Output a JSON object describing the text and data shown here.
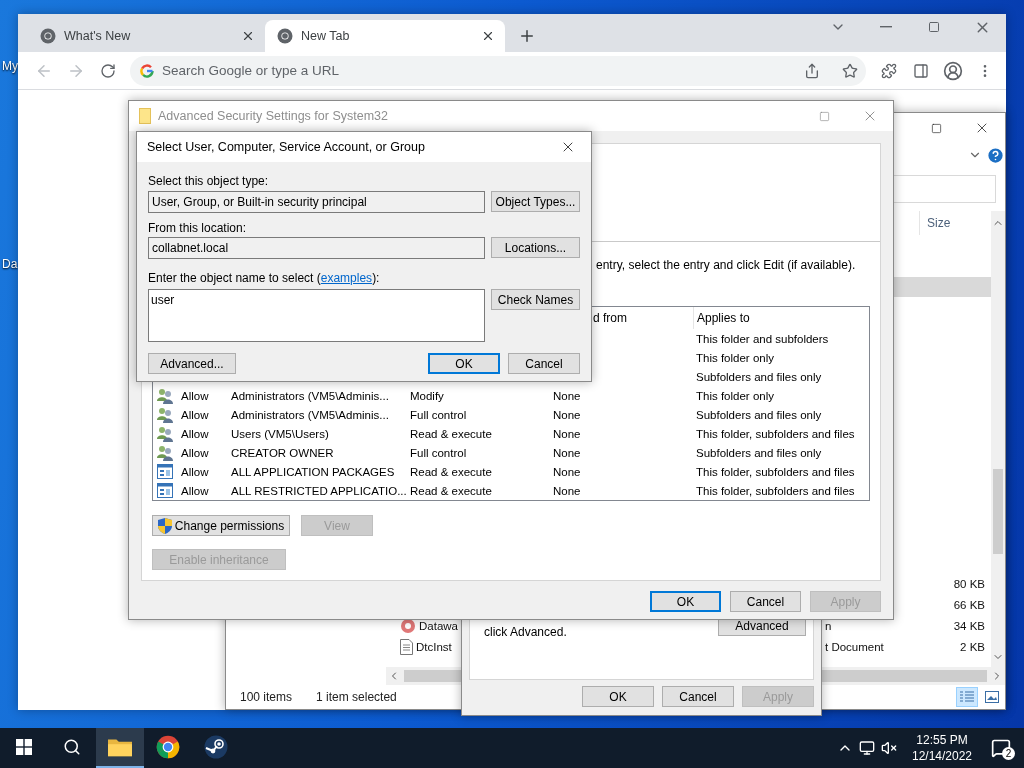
{
  "desktop": {
    "icon_labels": [
      "My",
      "Da"
    ]
  },
  "browser": {
    "tabs": [
      {
        "title": "What's New",
        "selected": false
      },
      {
        "title": "New Tab",
        "selected": true
      }
    ],
    "omnibox": {
      "placeholder": "Search Google or type a URL"
    }
  },
  "explorer": {
    "size_header": "Size",
    "rows": [
      {
        "selected": true
      },
      {
        "size": "80 KB",
        "selected": false
      },
      {
        "size": "66 KB",
        "selected": false
      },
      {
        "kind": "app",
        "name": "Datawa",
        "type": "n",
        "size": "34 KB",
        "selected": false
      },
      {
        "kind": "document",
        "name": "DtcInst",
        "type": "t Document",
        "size": "2 KB",
        "selected": false
      }
    ],
    "status": {
      "items": "100 items",
      "selection": "1 item selected"
    }
  },
  "properties": {
    "hint": "click Advanced.",
    "advanced_button": "Advanced",
    "buttons": [
      {
        "label": "OK",
        "disabled": false,
        "default": false
      },
      {
        "label": "Cancel",
        "disabled": false,
        "default": false
      },
      {
        "label": "Apply",
        "disabled": true,
        "default": false
      }
    ]
  },
  "security": {
    "title": "Advanced Security Settings for System32",
    "instruction": "entry, select the entry and click Edit (if available).",
    "columns": [
      {
        "label": "d from",
        "kind": "partial"
      },
      {
        "label": "Applies to",
        "kind": "full"
      }
    ],
    "entries": [
      {
        "applies_to": "This folder and subfolders"
      },
      {
        "applies_to": "This folder only"
      },
      {
        "applies_to": "Subfolders and files only"
      },
      {
        "kind": "group",
        "type": "Allow",
        "principal": "Administrators (VM5\\Adminis...",
        "access": "Modify",
        "inherited": "None",
        "applies_to": "This folder only"
      },
      {
        "kind": "group",
        "type": "Allow",
        "principal": "Administrators (VM5\\Adminis...",
        "access": "Full control",
        "inherited": "None",
        "applies_to": "Subfolders and files only"
      },
      {
        "kind": "group",
        "type": "Allow",
        "principal": "Users (VM5\\Users)",
        "access": "Read & execute",
        "inherited": "None",
        "applies_to": "This folder, subfolders and files"
      },
      {
        "kind": "group",
        "type": "Allow",
        "principal": "CREATOR OWNER",
        "access": "Full control",
        "inherited": "None",
        "applies_to": "Subfolders and files only"
      },
      {
        "kind": "package",
        "type": "Allow",
        "principal": "ALL APPLICATION PACKAGES",
        "access": "Read & execute",
        "inherited": "None",
        "applies_to": "This folder, subfolders and files"
      },
      {
        "kind": "package",
        "type": "Allow",
        "principal": "ALL RESTRICTED APPLICATIO...",
        "access": "Read & execute",
        "inherited": "None",
        "applies_to": "This folder, subfolders and files"
      }
    ],
    "actions": [
      {
        "label": "Change permissions",
        "kind": "elevated",
        "disabled": false
      },
      {
        "label": "View",
        "kind": "plain",
        "disabled": true
      }
    ],
    "inheritance_button": {
      "label": "Enable inheritance",
      "disabled": true
    },
    "buttons": [
      {
        "label": "OK",
        "disabled": false,
        "default": true
      },
      {
        "label": "Cancel",
        "disabled": false,
        "default": false
      },
      {
        "label": "Apply",
        "disabled": true,
        "default": false
      }
    ]
  },
  "select_dialog": {
    "title": "Select User, Computer, Service Account, or Group",
    "object_type": {
      "label": "Select this object type:",
      "value": "User, Group, or Built-in security principal",
      "button": "Object Types..."
    },
    "location": {
      "label": "From this location:",
      "value": "collabnet.local",
      "button": "Locations..."
    },
    "name_entry": {
      "label_start": "Enter the object name to select (",
      "link": "examples",
      "label_end": "):",
      "value": "user",
      "button": "Check Names"
    },
    "advanced_button": "Advanced...",
    "buttons": [
      {
        "label": "OK",
        "disabled": false,
        "default": true
      },
      {
        "label": "Cancel",
        "disabled": false,
        "default": false
      }
    ]
  },
  "taskbar": {
    "apps": [
      {
        "kind": "explorer",
        "active": true
      },
      {
        "kind": "chrome",
        "active": false
      },
      {
        "kind": "steam",
        "active": false
      }
    ],
    "time": "12:55 PM",
    "date": "12/14/2022",
    "notifications": "2"
  }
}
